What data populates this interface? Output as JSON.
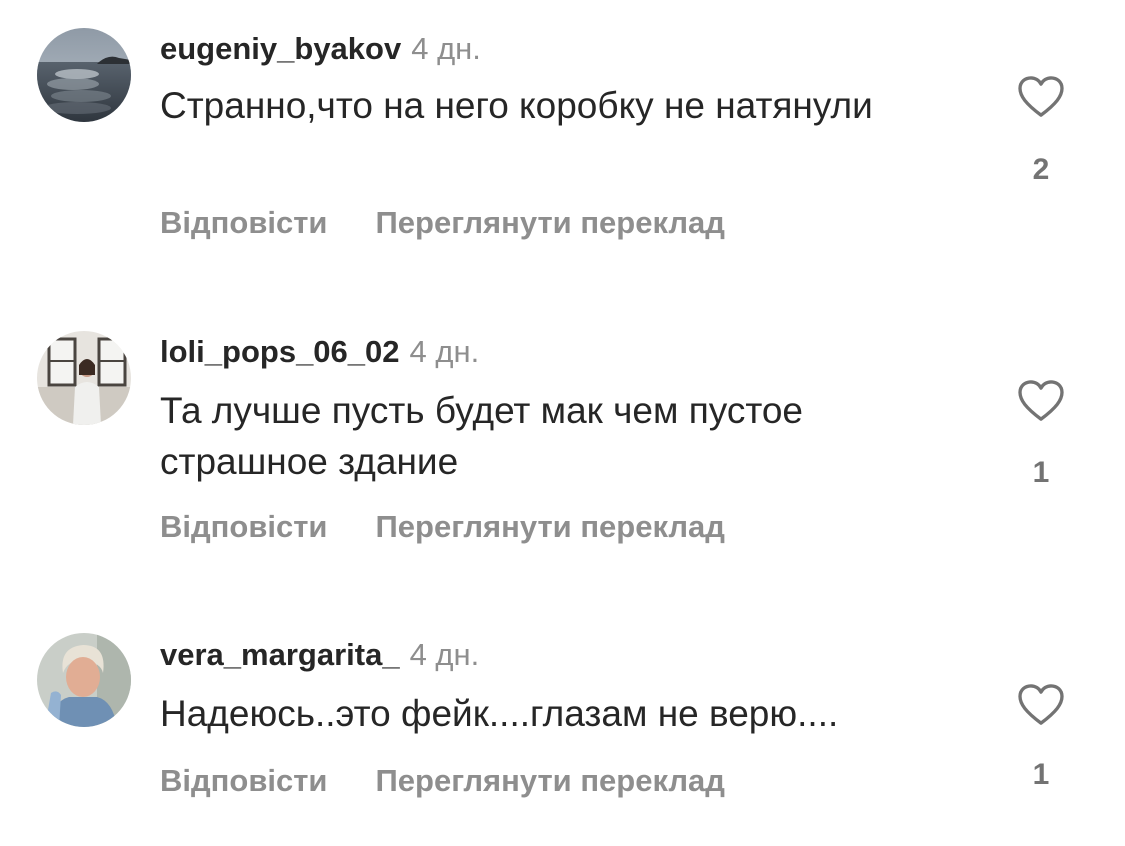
{
  "comments": [
    {
      "username": "eugeniy_byakov",
      "time": "4 дн.",
      "text": "Странно,что на него коробку не натянули",
      "likes": "2",
      "reply_label": "Відповісти",
      "translate_label": "Переглянути переклад",
      "avatar_icon": "sea-landscape-avatar"
    },
    {
      "username": "loli_pops_06_02",
      "time": "4 дн.",
      "text": "Та лучше пусть будет мак чем пустое страшное здание",
      "likes": "1",
      "reply_label": "Відповісти",
      "translate_label": "Переглянути переклад",
      "avatar_icon": "person-window-avatar"
    },
    {
      "username": "vera_margarita_",
      "time": "4 дн.",
      "text": "Надеюсь..это фейк....глазам не верю....",
      "likes": "1",
      "reply_label": "Відповісти",
      "translate_label": "Переглянути переклад",
      "avatar_icon": "woman-portrait-avatar"
    }
  ],
  "colors": {
    "primary_text": "#262626",
    "secondary_text": "#8e8e8e",
    "background": "#ffffff"
  }
}
